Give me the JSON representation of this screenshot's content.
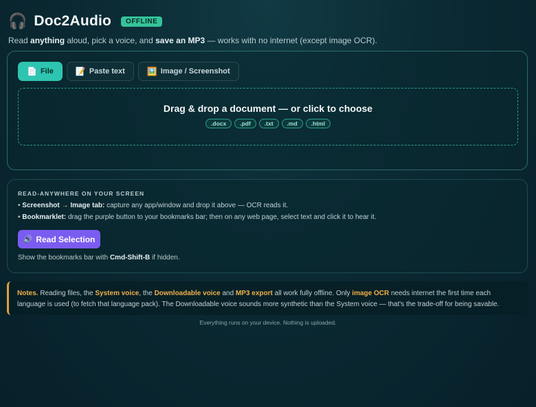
{
  "header": {
    "icon": "headphones-icon",
    "title": "Doc2Audio",
    "badge": "OFFLINE",
    "subtitle": {
      "p1": "Read ",
      "b1": "anything",
      "p2": " aloud, pick a voice, and ",
      "b2": "save an MP3",
      "p3": " — works with no internet (except image OCR)."
    }
  },
  "tabs": [
    {
      "icon": "📄",
      "label": "File",
      "active": true
    },
    {
      "icon": "📝",
      "label": "Paste text",
      "active": false
    },
    {
      "icon": "🖼️",
      "label": "Image / Screenshot",
      "active": false
    }
  ],
  "dropzone": {
    "title": "Drag & drop a document — or click to choose",
    "formats": [
      ".docx",
      ".pdf",
      ".txt",
      ".md",
      ".html"
    ]
  },
  "read_anywhere": {
    "heading": "READ-ANYWHERE ON YOUR SCREEN",
    "bullet1": {
      "dot": "• ",
      "b1": "Screenshot",
      "arrow": " → ",
      "b2": "Image tab:",
      "text": " capture any app/window and drop it above — OCR reads it."
    },
    "bullet2": {
      "dot": "• ",
      "b": "Bookmarklet:",
      "text": " drag the purple button to your bookmarks bar; then on any web page, select text and click it to hear it."
    },
    "button": {
      "icon": "🔊",
      "label": "Read Selection"
    },
    "hint": {
      "p1": "Show the bookmarks bar with ",
      "b": "Cmd-Shift-B",
      "p2": " if hidden."
    }
  },
  "notes": {
    "label": "Notes.",
    "t1": " Reading files, the ",
    "h1": "System voice",
    "t2": ", the ",
    "h2": "Downloadable voice",
    "t3": " and ",
    "h3": "MP3 export",
    "t4": " all work fully offline. Only ",
    "h4": "image OCR",
    "t5": " needs internet the first time each language is used (to fetch that language pack). The Downloadable voice sounds more synthetic than the System voice — that's the trade-off for being savable."
  },
  "footer": "Everything runs on your device. Nothing is uploaded.",
  "colors": {
    "accent_teal": "#2ec5b0",
    "badge_green": "#34c29a",
    "button_purple": "#7b5cf0",
    "note_orange": "#f0b04a"
  }
}
